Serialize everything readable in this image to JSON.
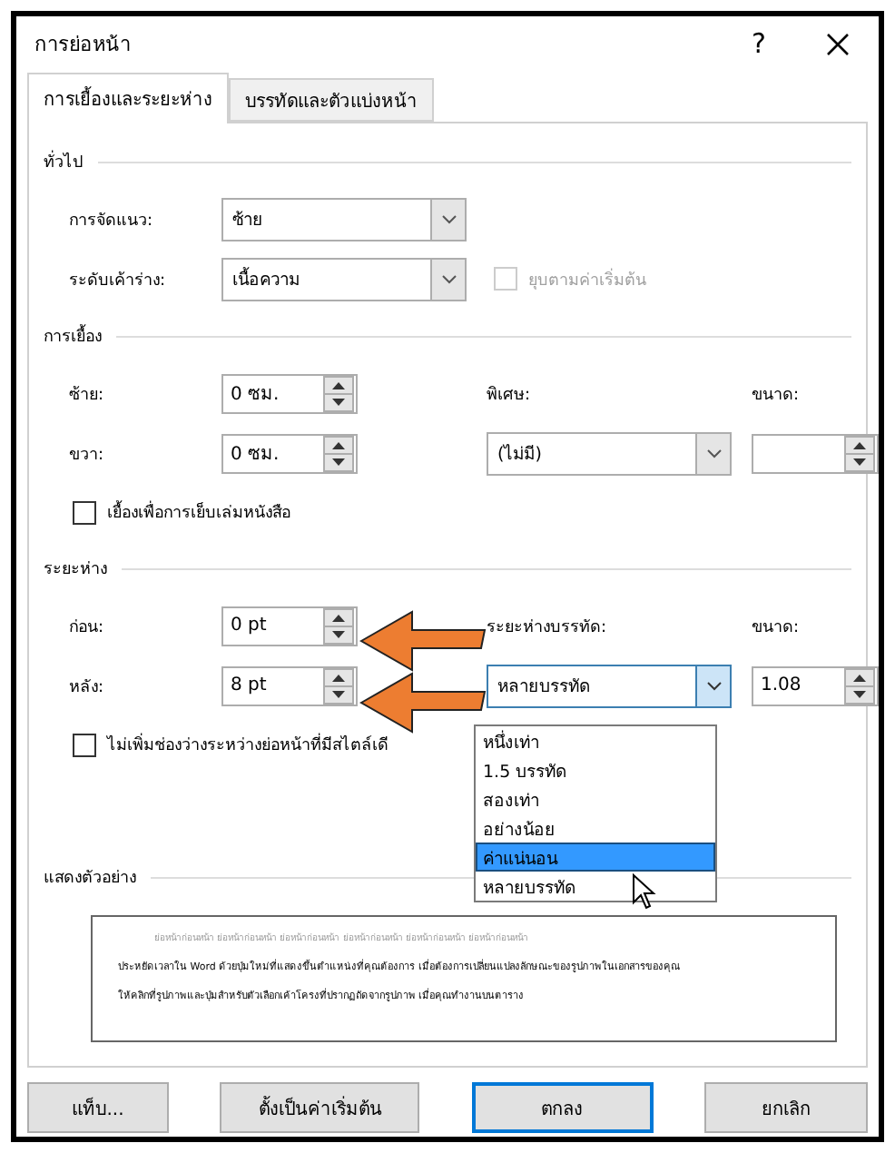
{
  "window": {
    "title": "การย่อหน้า",
    "help": "?"
  },
  "tabs": [
    {
      "label": "การเยื้องและระยะห่าง",
      "selected": true
    },
    {
      "label": "บรรทัดและตัวแบ่งหน้า",
      "selected": false
    }
  ],
  "general": {
    "heading": "ทั่วไป",
    "alignment": {
      "label": "การจัดแนว:",
      "value": "ซ้าย"
    },
    "outline_level": {
      "label": "ระดับเค้าร่าง:",
      "value": "เนื้อความ"
    },
    "collapse": {
      "label": "ยุบตามค่าเริ่มต้น",
      "checked": false,
      "disabled": true
    }
  },
  "indentation": {
    "heading": "การเยื้อง",
    "left": {
      "label": "ซ้าย:",
      "value": "0 ซม."
    },
    "right": {
      "label": "ขวา:",
      "value": "0 ซม."
    },
    "special": {
      "label": "พิเศษ:",
      "value": "(ไม่มี)"
    },
    "by": {
      "label": "ขนาด:"
    },
    "mirror": {
      "label": "เยื้องเพื่อการเย็บเล่มหนังสือ",
      "checked": false
    }
  },
  "spacing": {
    "heading": "ระยะห่าง",
    "before": {
      "label": "ก่อน:",
      "value": "0 pt"
    },
    "after": {
      "label": "หลัง:",
      "value": "8 pt"
    },
    "line_spacing": {
      "label": "ระยะห่างบรรทัด:",
      "value": "หลายบรรทัด",
      "open": true
    },
    "at": {
      "label": "ขนาด:",
      "value": "1.08"
    },
    "dont_add": {
      "label": "ไม่เพิ่มช่องว่างระหว่างย่อหน้าที่มีสไตล์เดี",
      "checked": false
    }
  },
  "line_spacing_options": [
    {
      "label": "หนึ่งเท่า",
      "selected": false
    },
    {
      "label": "1.5 บรรทัด",
      "selected": false
    },
    {
      "label": "สองเท่า",
      "selected": false
    },
    {
      "label": "อย่างน้อย",
      "selected": false
    },
    {
      "label": "ค่าแน่นอน",
      "selected": true
    },
    {
      "label": "หลายบรรทัด",
      "selected": false
    }
  ],
  "preview": {
    "heading": "แสดงตัวอย่าง",
    "previous": "ย่อหน้าก่อนหน้า ย่อหน้าก่อนหน้า ย่อหน้าก่อนหน้า ย่อหน้าก่อนหน้า ย่อหน้าก่อนหน้า ย่อหน้าก่อนหน้า",
    "sample": [
      "ประหยัดเวลาใน Word ด้วยปุ่มใหม่ที่แสดงขึ้นตำแหน่งที่คุณต้องการ เมื่อต้องการเปลี่ยนแปลงลักษณะของรูปภาพในเอกสารของคุณ",
      "ให้คลิกที่รูปภาพและปุ่มสำหรับตัวเลือกเค้าโครงที่ปรากฏถัดจากรูปภาพ เมื่อคุณทำงานบนตาราง"
    ]
  },
  "buttons": [
    {
      "label": "แท็บ...",
      "default": false
    },
    {
      "label": "ตั้งเป็นค่าเริ่มต้น",
      "default": false
    },
    {
      "label": "ตกลง",
      "default": true
    },
    {
      "label": "ยกเลิก",
      "default": false
    }
  ]
}
